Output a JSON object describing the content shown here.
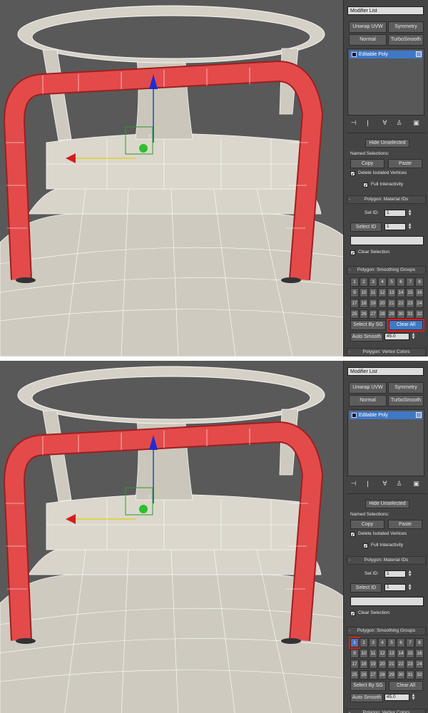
{
  "frames": [
    {
      "id": "top",
      "panel": {
        "modifier_list": "Modifier List",
        "buttons": [
          "Unwrap UVW",
          "Symmetry",
          "Normal",
          "TurboSmooth"
        ],
        "stack_item": "Editable Poly",
        "selection": {
          "hide_unselected": "Hide Unselected",
          "named_selections_label": "Named Selections:",
          "copy": "Copy",
          "paste": "Paste",
          "delete_isolated": "Delete Isolated Vertices",
          "full_interactivity": "Full Interactivity"
        },
        "material_ids": {
          "title": "Polygon: Material IDs",
          "set_id_label": "Set ID:",
          "set_id_value": "1",
          "select_id": "Select ID",
          "select_id_value": "1",
          "clear_selection": "Clear Selection"
        },
        "smoothing_groups": {
          "title": "Polygon: Smoothing Groups",
          "numbers": [
            "1",
            "2",
            "3",
            "4",
            "5",
            "6",
            "7",
            "8",
            "9",
            "10",
            "11",
            "12",
            "13",
            "14",
            "15",
            "16",
            "17",
            "18",
            "19",
            "20",
            "21",
            "22",
            "23",
            "24",
            "25",
            "26",
            "27",
            "28",
            "29",
            "30",
            "31",
            "32"
          ],
          "select_by_sg": "Select By SG",
          "clear_all": "Clear All",
          "auto_smooth": "Auto Smooth",
          "auto_smooth_value": "45.0"
        },
        "vertex_colors_title": "Polygon: Vertex Colors"
      }
    },
    {
      "id": "bottom",
      "panel": {
        "modifier_list": "Modifier List",
        "buttons": [
          "Unwrap UVW",
          "Symmetry",
          "Normal",
          "TurboSmooth"
        ],
        "stack_item": "Editable Poly",
        "selection": {
          "hide_unselected": "Hide Unselected",
          "named_selections_label": "Named Selections:",
          "copy": "Copy",
          "paste": "Paste",
          "delete_isolated": "Delete Isolated Vertices",
          "full_interactivity": "Full Interactivity"
        },
        "material_ids": {
          "title": "Polygon: Material IDs",
          "set_id_label": "Set ID:",
          "set_id_value": "1",
          "select_id": "Select ID",
          "select_id_value": "1",
          "clear_selection": "Clear Selection"
        },
        "smoothing_groups": {
          "title": "Polygon: Smoothing Groups",
          "numbers": [
            "1",
            "2",
            "3",
            "4",
            "5",
            "6",
            "7",
            "8",
            "9",
            "10",
            "11",
            "12",
            "13",
            "14",
            "15",
            "16",
            "17",
            "18",
            "19",
            "20",
            "21",
            "22",
            "23",
            "24",
            "25",
            "26",
            "27",
            "28",
            "29",
            "30",
            "31",
            "32"
          ],
          "select_by_sg": "Select By SG",
          "clear_all": "Clear All",
          "auto_smooth": "Auto Smooth",
          "auto_smooth_value": "45.0"
        },
        "vertex_colors_title": "Polygon: Vertex Colors"
      }
    }
  ],
  "viewport": {
    "gizmo_labels": {
      "x": "x",
      "y": "y",
      "z": "z"
    }
  },
  "colors": {
    "viewport_bg": "#595959",
    "mesh_surface": "#d8d3c9",
    "wire": "#ffffff",
    "selected_handle": "#e34b4b",
    "panel_bg": "#444444",
    "selection_blue": "#3f78c6",
    "highlight_red": "#e21b1b"
  }
}
